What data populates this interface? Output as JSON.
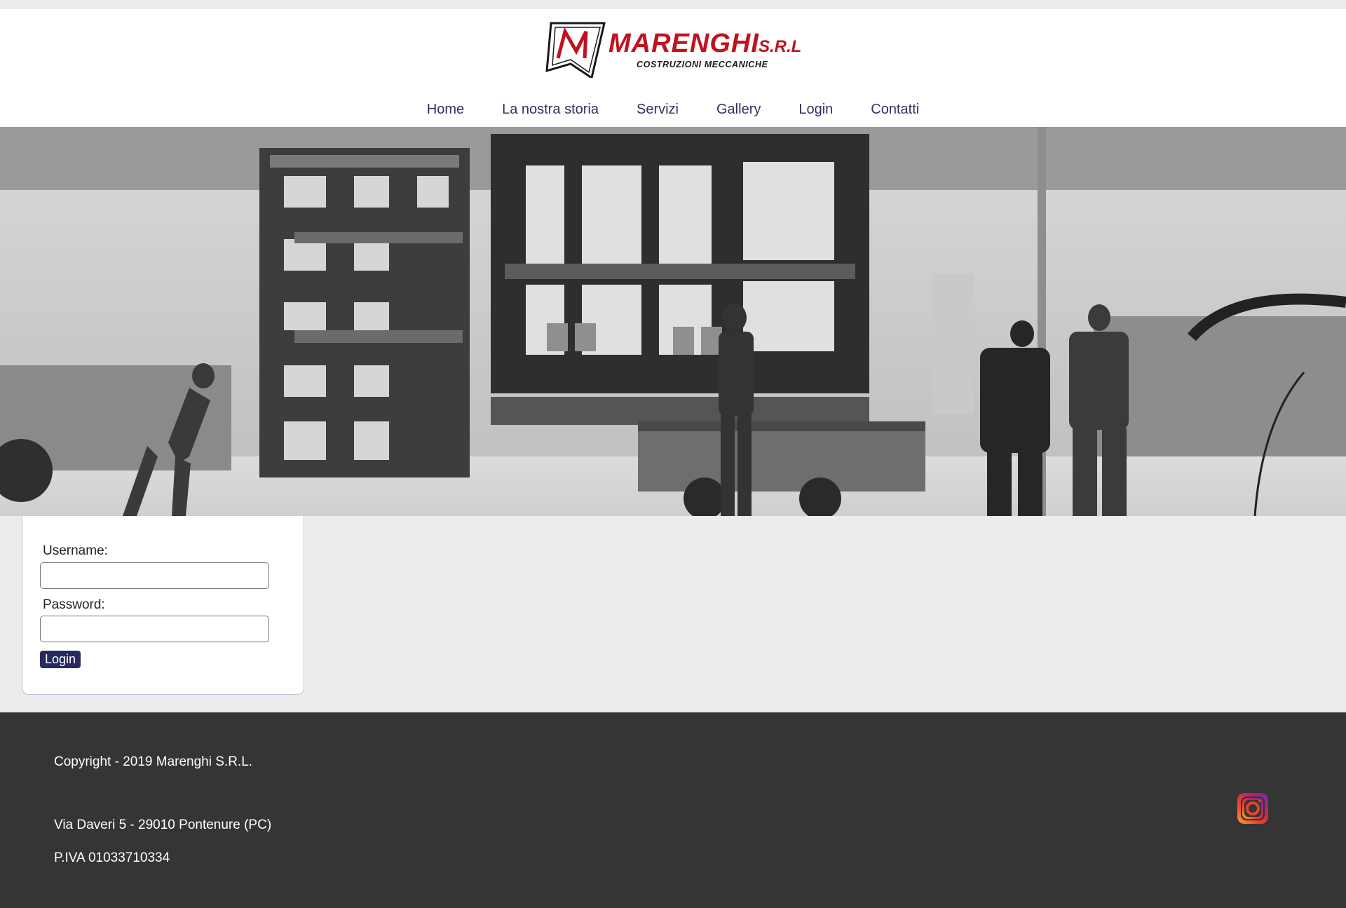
{
  "brand": {
    "name": "MARENGHI",
    "suffix": "S.R.L",
    "tagline": "COSTRUZIONI  MECCANICHE",
    "accent_color": "#c0121f"
  },
  "nav": {
    "items": [
      "Home",
      "La nostra storia",
      "Servizi",
      "Gallery",
      "Login",
      "Contatti"
    ],
    "color": "#2e3262"
  },
  "hero": {
    "icon": "workshop-photo"
  },
  "login": {
    "username_label": "Username:",
    "username_value": "",
    "password_label": "Password:",
    "password_value": "",
    "button_label": "Login",
    "button_color": "#272a5e"
  },
  "footer": {
    "copyright": "Copyright - 2019 Marenghi S.R.L.",
    "address": "Via Daveri 5 - 29010 Pontenure (PC)",
    "vat": "P.IVA 01033710334",
    "social_icon": "instagram-icon",
    "background": "#353535"
  }
}
